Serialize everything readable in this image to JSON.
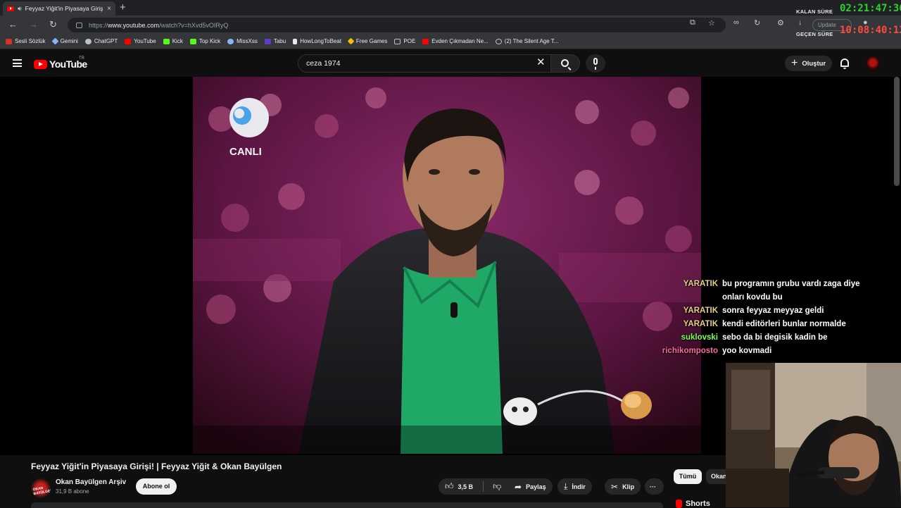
{
  "browser": {
    "tab_title": "Feyyaz Yiğit'in Piyasaya Giriş",
    "tab_close": "×",
    "new_tab": "+",
    "url_domain": "www.youtube.com",
    "url_prefix": "https://",
    "url_path": "/watch?v=hXvd5vOIRyQ",
    "update_label": "Update",
    "bookmarks": [
      {
        "label": "Sesli Sözlük",
        "color": "#d93025"
      },
      {
        "label": "Gemini",
        "color": "#8ab4f8"
      },
      {
        "label": "ChatGPT",
        "color": "#bdc1c6"
      },
      {
        "label": "YouTube",
        "color": "#ff0000"
      },
      {
        "label": "Kick",
        "color": "#53fc18"
      },
      {
        "label": "Top Kick",
        "color": "#53fc18"
      },
      {
        "label": "MissXss",
        "color": "#8ab4f8"
      },
      {
        "label": "Tabu",
        "color": "#5f3dc4"
      },
      {
        "label": "HowLongToBeat",
        "color": "#e8eaed"
      },
      {
        "label": "Free Games",
        "color": "#fbbc04"
      },
      {
        "label": "POE",
        "color": "#bdc1c6"
      },
      {
        "label": "Evden Çıkmadan Ne...",
        "color": "#ff0000"
      },
      {
        "label": "(2) The Silent Age T...",
        "color": "#bdc1c6"
      }
    ]
  },
  "timers": {
    "remaining_label": "KALAN SÜRE",
    "remaining_value": "02:21:47:36",
    "remaining_color": "#2ed12e",
    "elapsed_label": "GEÇEN SÜRE",
    "elapsed_value": "10:08:40:13",
    "elapsed_color": "#ff4a3d"
  },
  "youtube": {
    "logo_text": "YouTube",
    "region": "TR",
    "search_query": "ceza 1974",
    "create_label": "Oluştur"
  },
  "video_overlay": {
    "channel_logo_text": "CANLI"
  },
  "chat": [
    {
      "user": "YARATIK",
      "color": "#e6cf8a",
      "message": "bu programın grubu vardı zaga diye onları kovdu bu"
    },
    {
      "user": "YARATIK",
      "color": "#e6cf8a",
      "message": "sonra feyyaz meyyaz geldi"
    },
    {
      "user": "YARATIK",
      "color": "#e6cf8a",
      "message": "kendi editörleri bunlar normalde"
    },
    {
      "user": "suklovski",
      "color": "#7dff5a",
      "message": "sebo da bi degisik kadin be"
    },
    {
      "user": "richikomposto",
      "color": "#ff6b9a",
      "message": "yoo kovmadi"
    }
  ],
  "video_info": {
    "title": "Feyyaz Yiğit'in Piyasaya Girişi! | Feyyaz Yiğit & Okan Bayülgen",
    "channel_name": "Okan Bayülgen Arşiv",
    "channel_avatar_text": "OKAN BAYÜLGEN",
    "subscribers": "31,9 B abone",
    "subscribe_label": "Abone ol",
    "likes": "3,5 B",
    "share_label": "Paylaş",
    "download_label": "İndir",
    "clip_label": "Klip",
    "more_label": "···"
  },
  "sidebar": {
    "chip_all": "Tümü",
    "chip_channel": "Okan",
    "shorts_label": "Shorts"
  }
}
